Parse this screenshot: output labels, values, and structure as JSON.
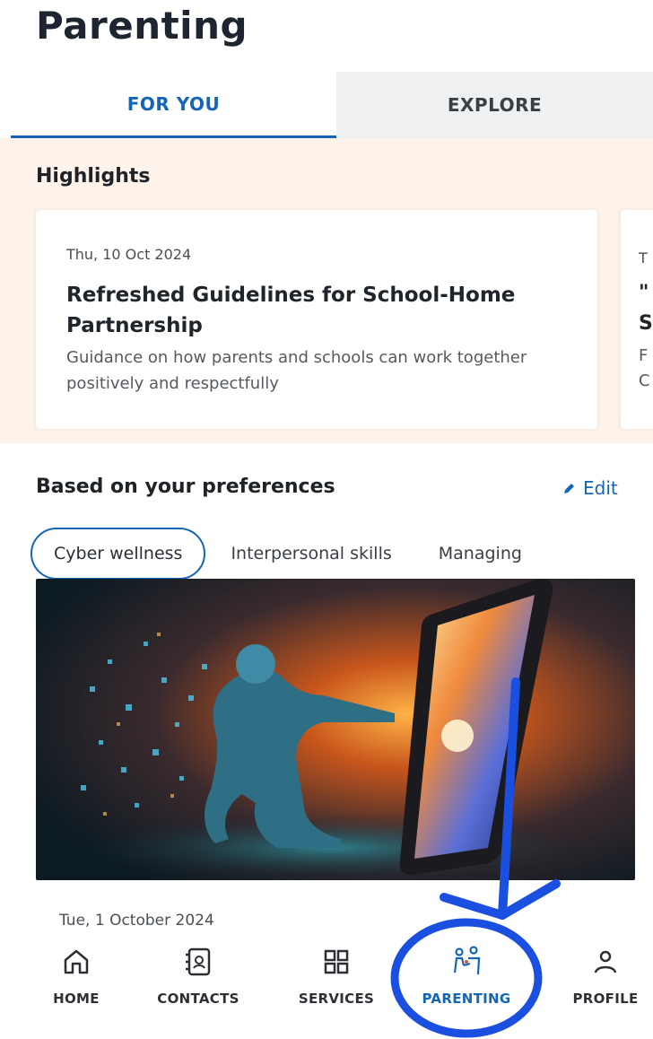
{
  "page": {
    "title": "Parenting"
  },
  "tabs": [
    {
      "label": "FOR YOU",
      "active": true
    },
    {
      "label": "EXPLORE",
      "active": false
    }
  ],
  "highlights": {
    "title": "Highlights",
    "cards": [
      {
        "date": "Thu, 10 Oct 2024",
        "headline": "Refreshed Guidelines for School-Home Partnership",
        "description": "Guidance on how parents and schools can work together positively and respectfully"
      },
      {
        "date": "T",
        "headline": "\"",
        "headline2": "S",
        "description": "F",
        "description2": "C"
      }
    ]
  },
  "preferences": {
    "title": "Based on your preferences",
    "edit_label": "Edit",
    "chips": [
      {
        "label": "Cyber wellness",
        "active": true
      },
      {
        "label": "Interpersonal skills",
        "active": false
      },
      {
        "label": "Managing",
        "active": false
      }
    ]
  },
  "article": {
    "date": "Tue, 1 October 2024"
  },
  "bottom_nav": [
    {
      "label": "HOME",
      "icon": "home-icon"
    },
    {
      "label": "CONTACTS",
      "icon": "contacts-icon"
    },
    {
      "label": "SERVICES",
      "icon": "services-grid-icon"
    },
    {
      "label": "PARENTING",
      "icon": "parenting-icon",
      "active": true
    },
    {
      "label": "PROFILE",
      "icon": "profile-icon"
    }
  ],
  "colors": {
    "accent": "#1565b7",
    "highlight_bg": "#fdf3ea",
    "annotation": "#1a4fe0"
  }
}
